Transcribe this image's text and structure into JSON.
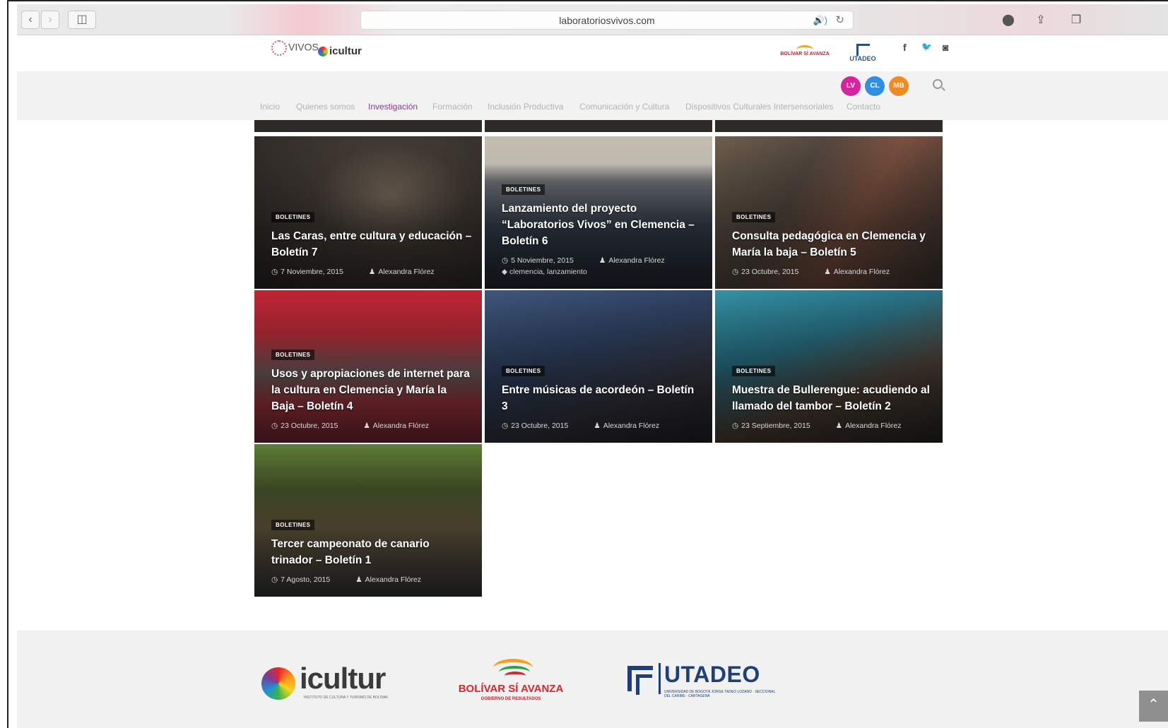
{
  "browser": {
    "url": "laboratoriosvivos.com",
    "back_glyph": "‹",
    "forward_glyph": "›",
    "sidebar_glyph": "◫",
    "audio_glyph": "🔊)",
    "reload_glyph": "↻",
    "download_glyph": "⬤",
    "share_glyph": "⇪",
    "tabs_glyph": "❐"
  },
  "header": {
    "logo_vivos": "VIVOS",
    "logo_icultur": "icultur",
    "bolivar_logo_text": "BOLÍVAR SÍ AVANZA",
    "utadeo_logo_text": "UTADEO",
    "social": {
      "facebook": "f",
      "twitter": "🐦",
      "instagram": "◙"
    }
  },
  "lang_circles": [
    {
      "label": "LV",
      "color": "#d6239f"
    },
    {
      "label": "CL",
      "color": "#2f8fe0"
    },
    {
      "label": "MB",
      "color": "#f08a24"
    }
  ],
  "nav": {
    "items": [
      "Inicio",
      "Quienes somos",
      "Investigación",
      "Formación",
      "Inclusión Productiva",
      "Comunicación y Cultura",
      "Dispositivos Culturales Intersensoriales",
      "Contacto"
    ],
    "active": "Investigación"
  },
  "posts": [
    {
      "badge": "BOLETINES",
      "title": "Las Caras, entre cultura y educación – Boletín 7",
      "date": "7 Noviembre, 2015",
      "author": "Alexandra Flórez",
      "tags": ""
    },
    {
      "badge": "BOLETINES",
      "title": "Lanzamiento del proyecto “Laboratorios Vivos” en Clemencia – Boletín 6",
      "date": "5 Noviembre, 2015",
      "author": "Alexandra Flórez",
      "tags": "clemencia, lanzamiento"
    },
    {
      "badge": "BOLETINES",
      "title": "Consulta pedagógica en Clemencia y María la baja – Boletín 5",
      "date": "23 Octubre, 2015",
      "author": "Alexandra Flórez",
      "tags": ""
    },
    {
      "badge": "BOLETINES",
      "title": "Usos y apropiaciones de internet para la cultura en Clemencia y María la Baja – Boletín 4",
      "date": "23 Octubre, 2015",
      "author": "Alexandra Flórez",
      "tags": ""
    },
    {
      "badge": "BOLETINES",
      "title": "Entre músicas de acordeón – Boletín 3",
      "date": "23 Octubre, 2015",
      "author": "Alexandra Flórez",
      "tags": ""
    },
    {
      "badge": "BOLETINES",
      "title": "Muestra de Bullerengue: acudiendo al llamado del tambor – Boletín 2",
      "date": "23 Septiembre, 2015",
      "author": "Alexandra Flórez",
      "tags": ""
    },
    {
      "badge": "BOLETINES",
      "title": "Tercer campeonato de canario trinador – Boletín 1",
      "date": "7 Agosto, 2015",
      "author": "Alexandra Flórez",
      "tags": ""
    }
  ],
  "footer": {
    "icultur": "icultur",
    "icultur_sub": "INSTITUTO DE CULTURA Y TURISMO DE BOLÍVAR",
    "bolivar": "BOLÍVAR SÍ AVANZA",
    "bolivar_sub": "GOBIERNO DE RESULTADOS",
    "utadeo": "UTADEO",
    "utadeo_sub": "UNIVERSIDAD DE BOGOTÁ JORGE TADEO LOZANO · SECCIONAL DEL CARIBE · CARTAGENA"
  },
  "scroll_top_glyph": "⌃",
  "icons": {
    "clock": "◷",
    "author": "♟",
    "tag": "◆"
  }
}
